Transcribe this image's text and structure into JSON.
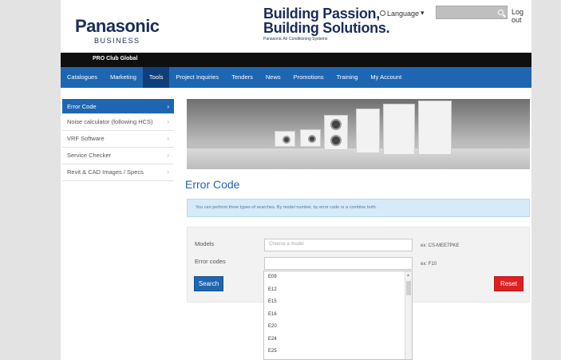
{
  "brand": {
    "name": "Panasonic",
    "sub": "BUSINESS"
  },
  "tagline": {
    "line1": "Building Passion,",
    "line2": "Building Solutions.",
    "sub": "Panasonic Air Conditioning Systems"
  },
  "header": {
    "language_label": "Language",
    "search_placeholder": "",
    "login_label": "Log out"
  },
  "club": {
    "label": "PRO Club Global"
  },
  "nav": {
    "items": [
      {
        "label": "Catalogues"
      },
      {
        "label": "Marketing"
      },
      {
        "label": "Tools",
        "active": true
      },
      {
        "label": "Project Inquiries"
      },
      {
        "label": "Tenders"
      },
      {
        "label": "News"
      },
      {
        "label": "Promotions"
      },
      {
        "label": "Training"
      },
      {
        "label": "My Account"
      }
    ]
  },
  "sidebar": {
    "items": [
      {
        "label": "Error Code",
        "active": true
      },
      {
        "label": "Noise calculator (following HCS)"
      },
      {
        "label": "VRF Software"
      },
      {
        "label": "Service Checker"
      },
      {
        "label": "Revit & CAD Images / Specs"
      }
    ]
  },
  "page": {
    "title": "Error Code",
    "info": "You can perform three types of searches. By model number, by error code or a combine both."
  },
  "form": {
    "models_label": "Models",
    "models_placeholder": "Choose a model",
    "models_note": "ex: CS-MEE7PKE",
    "error_label": "Error codes",
    "error_value": "",
    "error_note": "ex: F10",
    "search_label": "Search",
    "reset_label": "Reset"
  },
  "error_options": [
    "E09",
    "E12",
    "E15",
    "E16",
    "E20",
    "E24",
    "E25"
  ],
  "colors": {
    "brand_blue": "#1e66b1",
    "nav_active": "#0f3f7a",
    "reset_red": "#e02020",
    "navy": "#1b2d5a"
  }
}
